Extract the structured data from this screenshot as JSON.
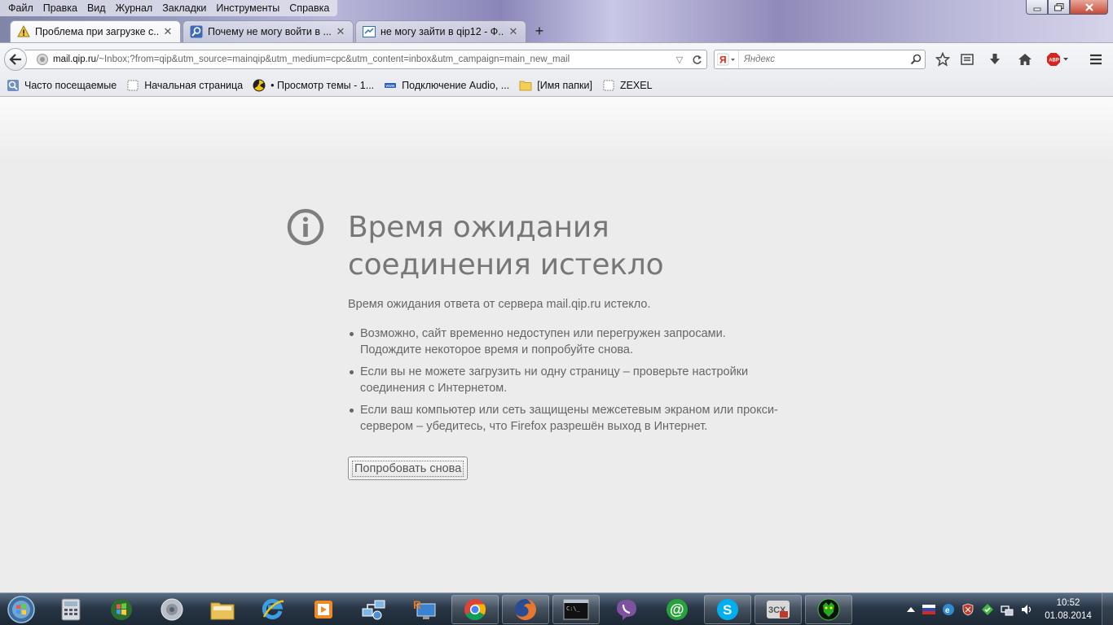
{
  "menubar": {
    "items": [
      {
        "label": "Файл"
      },
      {
        "label": "Правка"
      },
      {
        "label": "Вид"
      },
      {
        "label": "Журнал"
      },
      {
        "label": "Закладки"
      },
      {
        "label": "Инструменты"
      },
      {
        "label": "Справка"
      }
    ]
  },
  "tabs": [
    {
      "title": "Проблема при загрузке с...",
      "icon": "warning-icon",
      "active": true
    },
    {
      "title": "Почему не могу войти в ...",
      "icon": "search-page-icon",
      "active": false
    },
    {
      "title": "не могу зайти в qip12 - Ф...",
      "icon": "forum-page-icon",
      "active": false
    }
  ],
  "newtab_label": "+",
  "urlbar": {
    "host": "mail.qip.ru",
    "rest": "/~Inbox;?from=qip&utm_source=mainqip&utm_medium=cpc&utm_content=inbox&utm_campaign=main_new_mail"
  },
  "search": {
    "placeholder": "Яндекс",
    "engine_icon": "yandex-icon"
  },
  "bookmarks": [
    {
      "label": "Часто посещаемые",
      "icon": "most-visited-icon"
    },
    {
      "label": "Начальная страница",
      "icon": "page-icon"
    },
    {
      "label": "• Просмотр темы - 1...",
      "icon": "radiation-icon"
    },
    {
      "label": "Подключение Audio, ...",
      "icon": "link-icon"
    },
    {
      "label": "[Имя папки]",
      "icon": "folder-icon"
    },
    {
      "label": "ZEXEL",
      "icon": "page-icon"
    }
  ],
  "error": {
    "title": "Время ожидания соединения истекло",
    "description": "Время ожидания ответа от сервера mail.qip.ru истекло.",
    "items": [
      "Возможно, сайт временно недоступен или перегружен запросами. Подождите некоторое время и попробуйте снова.",
      "Если вы не можете загрузить ни одну страницу – проверьте настройки соединения с Интернетом.",
      "Если ваш компьютер или сеть защищены межсетевым экраном или прокси-сервером – убедитесь, что Firefox разрешён выход в Интернет."
    ],
    "retry_label": "Попробовать снова"
  },
  "taskbar": {
    "apps": [
      "calculator-icon",
      "windows-media-center-icon",
      "speaker-icon",
      "explorer-folder-icon",
      "internet-explorer-icon",
      "media-player-icon",
      "network-icon",
      "remote-desktop-icon",
      "chrome-icon",
      "firefox-icon",
      "command-prompt-icon",
      "viber-icon",
      "mail-agent-icon",
      "skype-icon",
      "3cx-phone-icon",
      "panther-app-icon"
    ],
    "tray_language": "RU",
    "clock_time": "10:52",
    "clock_date": "01.08.2014"
  },
  "colors": {
    "error_text": "#777777",
    "content_background": "#ececec",
    "taskbar": "#283646"
  }
}
